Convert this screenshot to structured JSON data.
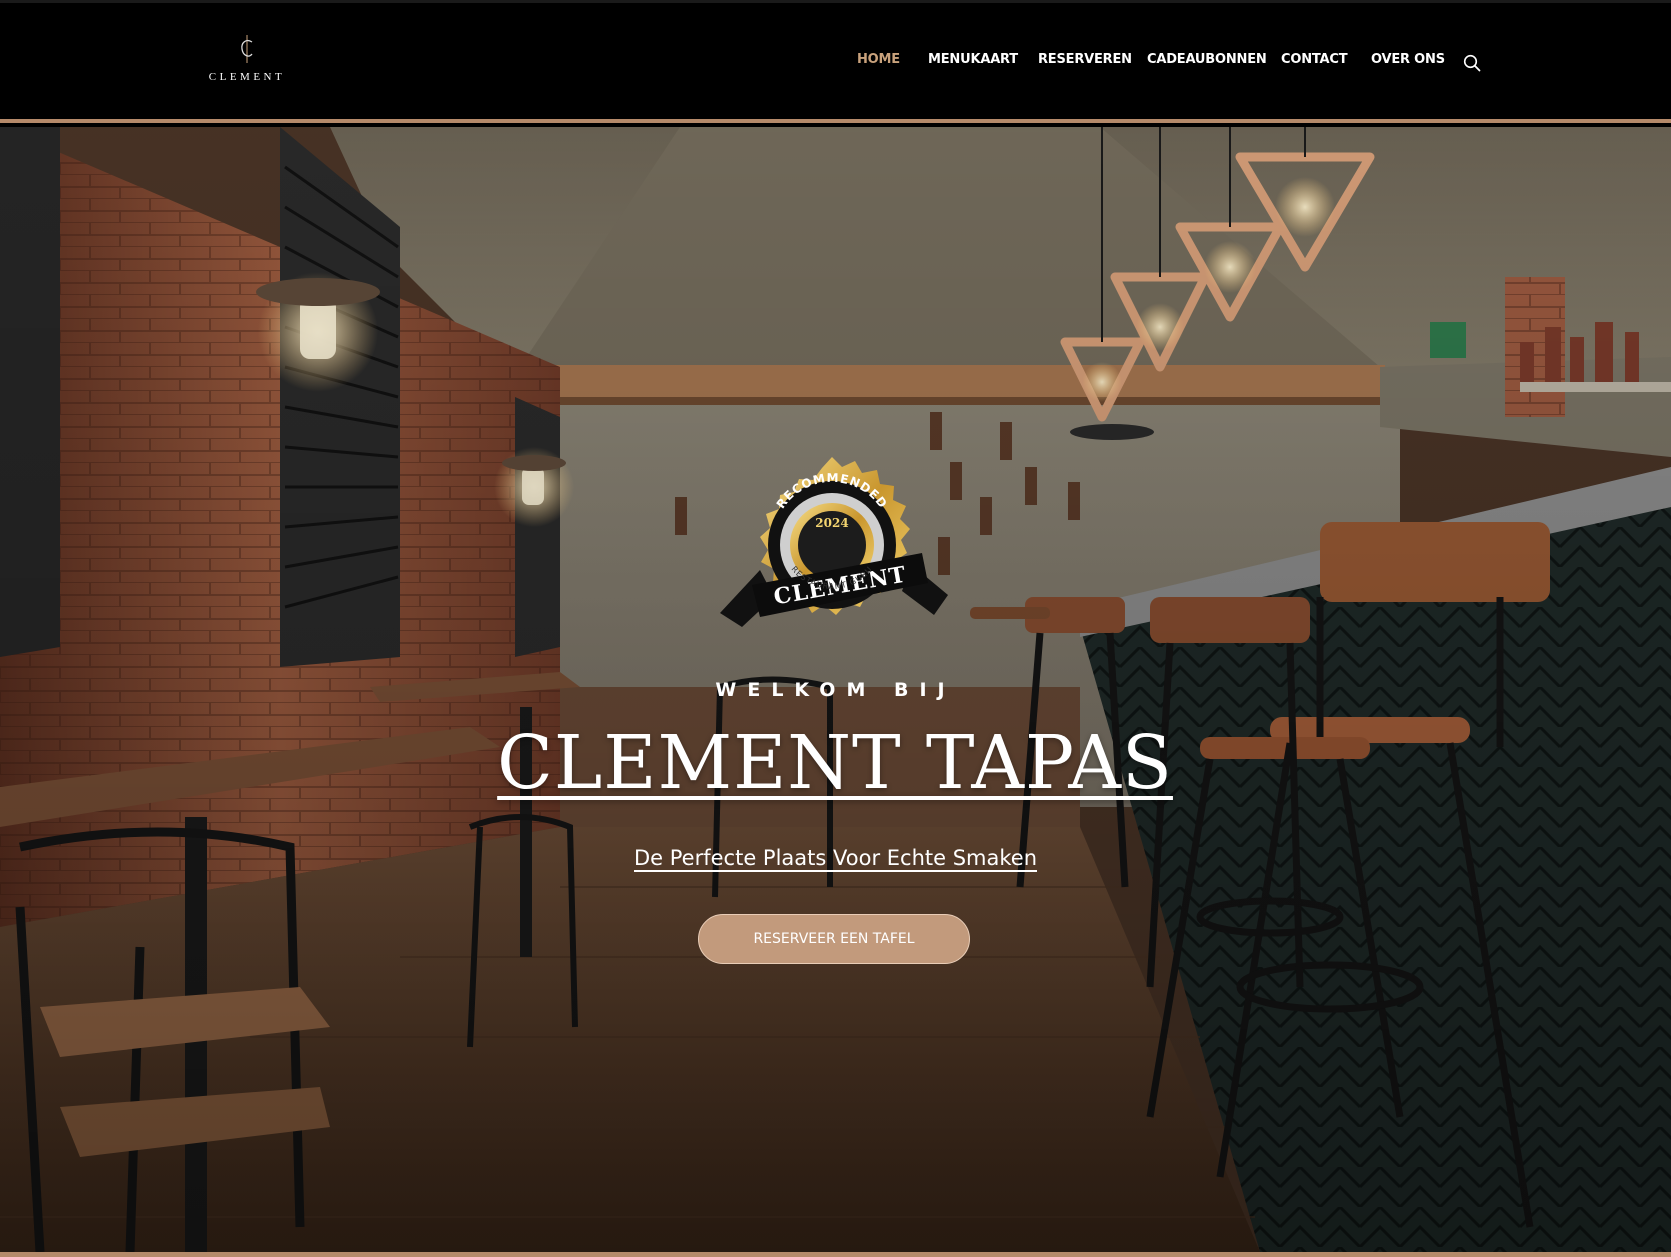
{
  "brand": {
    "logo_text": "CLEMENT"
  },
  "nav": {
    "items": [
      {
        "label": "HOME"
      },
      {
        "label": "MENUKAART"
      },
      {
        "label": "RESERVEREN"
      },
      {
        "label": "CADEAUBONNEN"
      },
      {
        "label": "CONTACT"
      },
      {
        "label": "OVER ONS"
      }
    ],
    "active_index": 0,
    "search_icon": "search-icon"
  },
  "badge": {
    "top_text": "RECOMMENDED",
    "year": "2024",
    "name": "CLEMENT",
    "bottom_text": "RESTAURANT GURU"
  },
  "hero": {
    "welcome": "WELKOM BIJ",
    "title": "CLEMENT TAPAS",
    "subtitle": "De Perfecte Plaats Voor Echte Smaken",
    "cta_label": "RESERVEER EEN TAFEL"
  },
  "colors": {
    "accent": "#c29a7c",
    "active_nav": "#c9a27c",
    "header_bg": "#000000",
    "border": "#b58a6a"
  }
}
